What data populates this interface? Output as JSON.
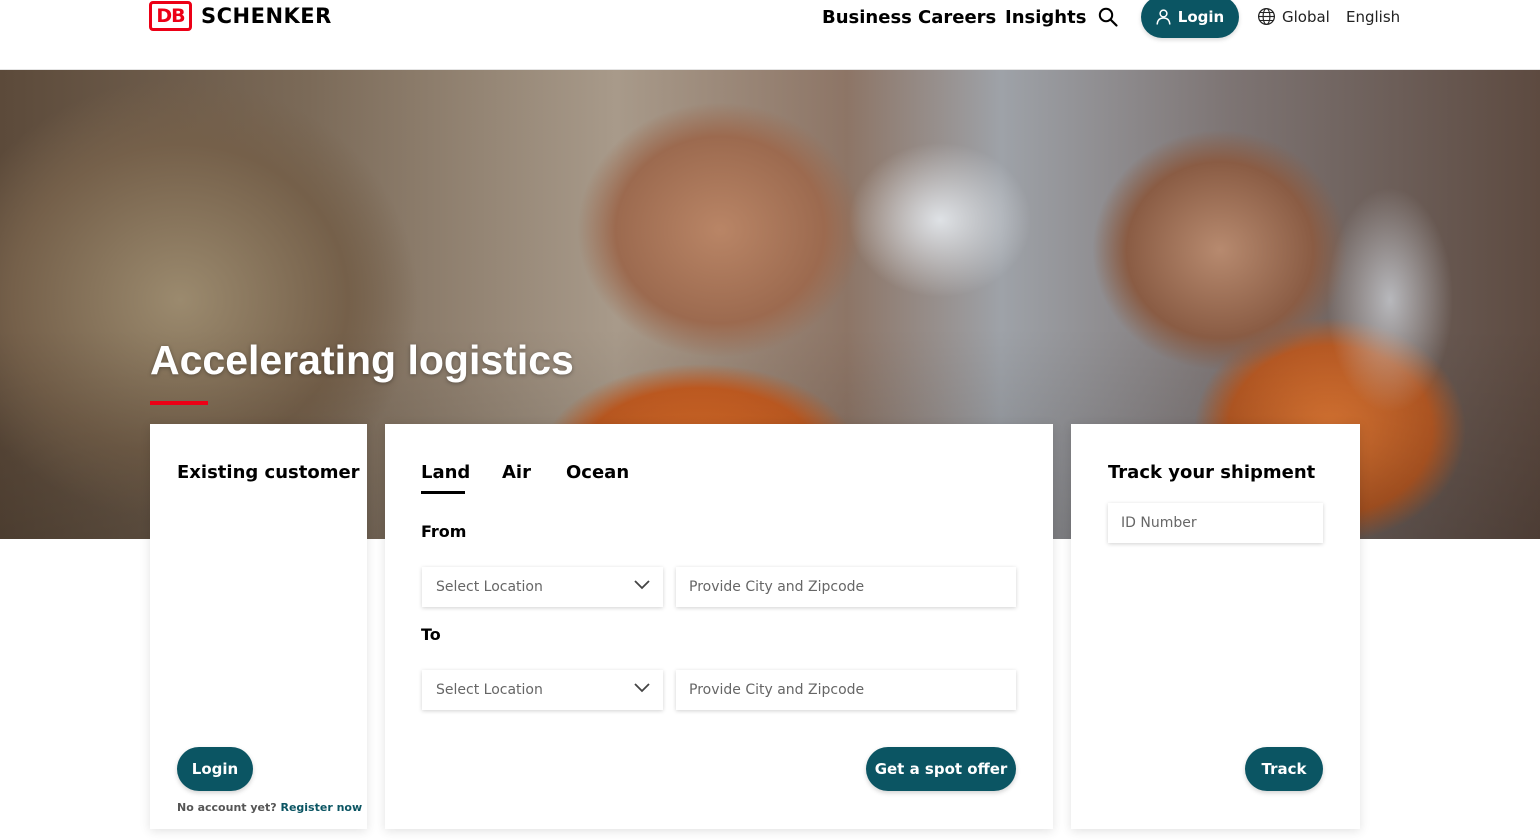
{
  "header": {
    "logo_mark": "DB",
    "logo_text": "SCHENKER",
    "nav": [
      "Business",
      "Careers",
      "Insights"
    ],
    "search_icon": "search-icon",
    "login_label": "Login",
    "login_icon": "user-icon",
    "region_icon": "globe-icon",
    "region_label": "Global",
    "language_label": "English"
  },
  "hero": {
    "title": "Accelerating logistics",
    "accent_color": "#ec0016"
  },
  "existing_customer": {
    "title": "Existing customer",
    "login_label": "Login",
    "no_account_text": "No account yet?",
    "register_link": "Register now"
  },
  "quote": {
    "tabs": [
      "Land",
      "Air",
      "Ocean"
    ],
    "active_tab": "Land",
    "from_label": "From",
    "to_label": "To",
    "location_placeholder": "Select Location",
    "city_placeholder": "Provide City and Zipcode",
    "submit_label": "Get a spot offer"
  },
  "tracking": {
    "title": "Track your shipment",
    "id_placeholder": "ID Number",
    "submit_label": "Track"
  },
  "colors": {
    "brand_red": "#ec0016",
    "primary_button": "#0b5563"
  }
}
